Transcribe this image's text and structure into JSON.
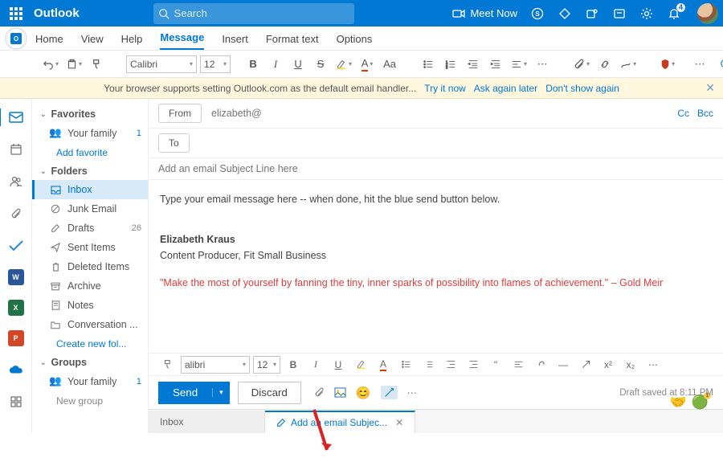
{
  "topbar": {
    "brand": "Outlook",
    "search_placeholder": "Search",
    "meet_now": "Meet Now",
    "notif_count": "4"
  },
  "ribbon_tabs": [
    "Home",
    "View",
    "Help",
    "Message",
    "Insert",
    "Format text",
    "Options"
  ],
  "ribbon_active": 3,
  "toolbar": {
    "font": "Calibri",
    "size": "12"
  },
  "notif_bar": {
    "msg": "Your browser supports setting Outlook.com as the default email handler...",
    "links": [
      "Try it now",
      "Ask again later",
      "Don't show again"
    ]
  },
  "sidebar": {
    "favorites": "Favorites",
    "folders": "Folders",
    "groups": "Groups",
    "add_favorite": "Add favorite",
    "create_folder": "Create new fol...",
    "new_group": "New group",
    "items": {
      "your_family": "Your family",
      "inbox": "Inbox",
      "junk": "Junk Email",
      "drafts": "Drafts",
      "sent": "Sent Items",
      "deleted": "Deleted Items",
      "archive": "Archive",
      "notes": "Notes",
      "conversation": "Conversation ..."
    },
    "counts": {
      "your_family": "1",
      "drafts": "26",
      "your_family2": "1"
    }
  },
  "compose": {
    "from_label": "From",
    "from_value": "elizabeth@",
    "to_label": "To",
    "cc": "Cc",
    "bcc": "Bcc",
    "subject_placeholder": "Add an email Subject Line here",
    "body_placeholder": "Type your email message here -- when done, hit the blue send button below.",
    "sig_name": "Elizabeth Kraus",
    "sig_title": "Content Producer, Fit Small Business",
    "quote": "\"Make the most of yourself by fanning the tiny, inner sparks of possibility into flames of achievement.\" – Gold Meir"
  },
  "bottom_toolbar": {
    "font": "alibri",
    "size": "12"
  },
  "send_row": {
    "send": "Send",
    "discard": "Discard",
    "draft_saved": "Draft saved at 8:11 PM"
  },
  "bottom_tabs": {
    "inbox": "Inbox",
    "compose": "Add an email Subjec..."
  }
}
